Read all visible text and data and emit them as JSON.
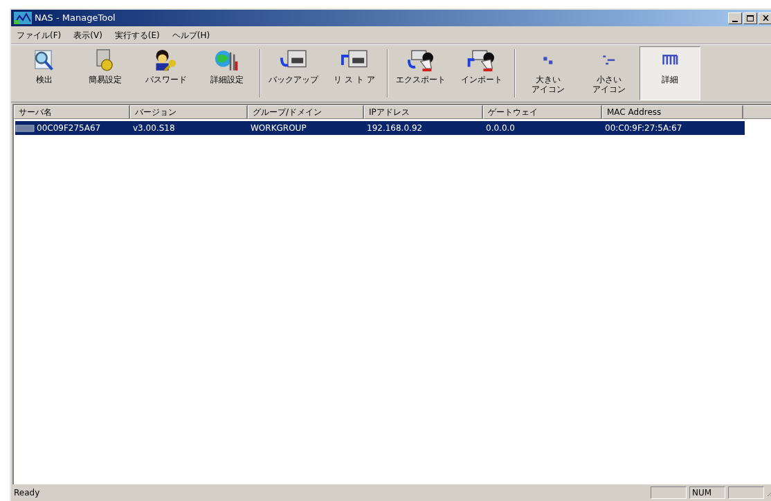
{
  "window": {
    "title": "NAS - ManageTool"
  },
  "menu": [
    "ファイル(F)",
    "表示(V)",
    "実行する(E)",
    "ヘルプ(H)"
  ],
  "toolbar": [
    {
      "buttons": [
        {
          "label": "検出",
          "kind": "detect"
        },
        {
          "label": "簡易設定",
          "kind": "easy"
        },
        {
          "label": "パスワード",
          "kind": "password"
        },
        {
          "label": "詳細設定",
          "kind": "advanced"
        }
      ]
    },
    {
      "buttons": [
        {
          "label": "バックアップ",
          "kind": "backup"
        },
        {
          "label": "リ ス ト ア",
          "kind": "restore"
        }
      ]
    },
    {
      "buttons": [
        {
          "label": "エクスポート",
          "kind": "export"
        },
        {
          "label": "インポート",
          "kind": "import"
        }
      ]
    },
    {
      "buttons": [
        {
          "label": [
            "大きい",
            "アイコン"
          ],
          "kind": "large",
          "selected": false
        },
        {
          "label": [
            "小さい",
            "アイコン"
          ],
          "kind": "small",
          "selected": false
        },
        {
          "label": "詳細",
          "kind": "details",
          "selected": true
        }
      ]
    }
  ],
  "table": {
    "columns": [
      "サーバ名",
      "バージョン",
      "グループ/ドメイン",
      "IPアドレス",
      "ゲートウェイ",
      "MAC Address"
    ],
    "rows": [
      {
        "selected": true,
        "cells": [
          "00C09F275A67",
          "v3.00.S18",
          "WORKGROUP",
          "192.168.0.92",
          "0.0.0.0",
          "00:C0:9F:27:5A:67"
        ]
      }
    ]
  },
  "status_bar": {
    "text": "Ready",
    "num_indicator": "NUM"
  }
}
